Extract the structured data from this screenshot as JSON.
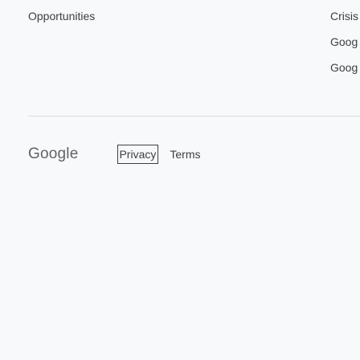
{
  "top": {
    "left_link": "Opportunities",
    "right_links": [
      "Crisis",
      "Goog",
      "Goog"
    ]
  },
  "footer": {
    "logo_text": "Google",
    "privacy_label": "Privacy",
    "terms_label": "Terms"
  }
}
